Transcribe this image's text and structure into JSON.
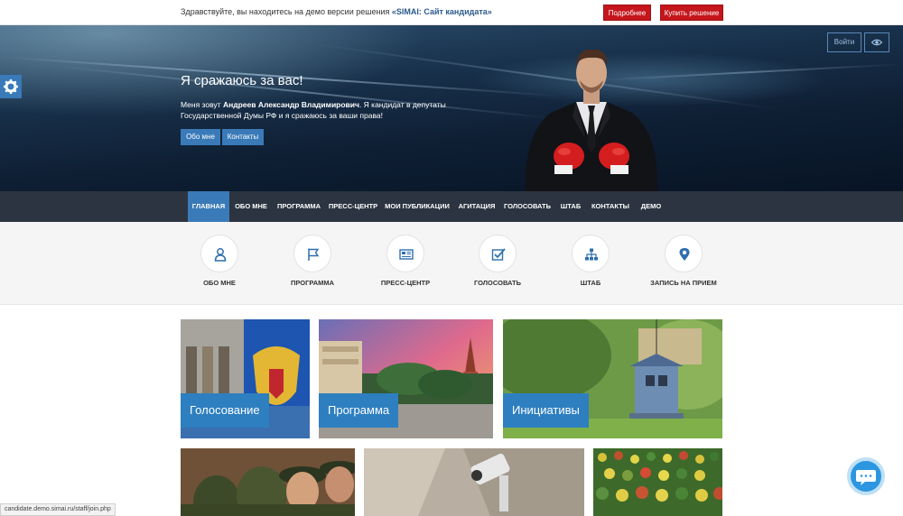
{
  "topbar": {
    "text_prefix": "Здравствуйте, вы находитесь на демо версии решения ",
    "text_solution": "«SIMAI: Сайт кандидата»",
    "more_label": "Подробнее",
    "buy_label": "Купить решение"
  },
  "hero": {
    "title": "Я сражаюсь за вас!",
    "desc_prefix": "Меня зовут ",
    "desc_name": "Андреев Александр Владимирович",
    "desc_suffix": ". Я кандидат в депутаты Государственной Думы РФ и я сражаюсь за ваши права!",
    "about_btn": "Обо мне",
    "contacts_btn": "Контакты",
    "login_label": "Войти",
    "eye_icon": "eye-icon",
    "gear_icon": "gear-icon"
  },
  "nav": {
    "items": [
      {
        "label": "ГЛАВНАЯ",
        "active": true
      },
      {
        "label": "ОБО МНЕ"
      },
      {
        "label": "ПРОГРАММА"
      },
      {
        "label": "ПРЕСС-ЦЕНТР"
      },
      {
        "label": "МОИ ПУБЛИКАЦИИ"
      },
      {
        "label": "АГИТАЦИЯ"
      },
      {
        "label": "ГОЛОСОВАТЬ"
      },
      {
        "label": "ШТАБ"
      },
      {
        "label": "КОНТАКТЫ"
      },
      {
        "label": "ДЕМО"
      }
    ]
  },
  "features": {
    "items": [
      {
        "label": "ОБО МНЕ",
        "icon": "user-icon"
      },
      {
        "label": "ПРОГРАММА",
        "icon": "flag-icon"
      },
      {
        "label": "ПРЕСС-ЦЕНТР",
        "icon": "newspaper-icon"
      },
      {
        "label": "ГОЛОСОВАТЬ",
        "icon": "checkbox-icon"
      },
      {
        "label": "ШТАБ",
        "icon": "sitemap-icon"
      },
      {
        "label": "ЗАПИСЬ НА ПРИЕМ",
        "icon": "map-marker-icon"
      }
    ]
  },
  "tiles": {
    "items": [
      {
        "label": "Голосование"
      },
      {
        "label": "Программа"
      },
      {
        "label": "Инициативы"
      }
    ]
  },
  "status_url": "candidate.demo.simai.ru/staff/join.php",
  "colors": {
    "accent": "#3a7ab8",
    "tile_label": "#2e7fc0",
    "nav_bg": "#2b3440",
    "demo_red": "#c4161c"
  }
}
